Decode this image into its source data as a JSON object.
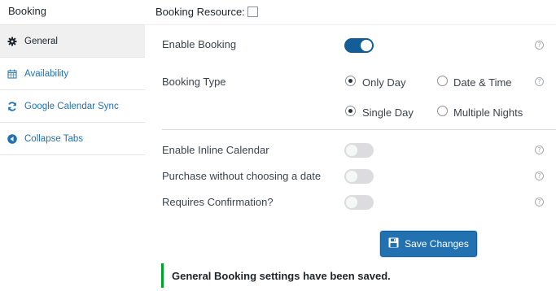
{
  "sidebar": {
    "title": "Booking",
    "items": [
      {
        "label": "General",
        "icon": "gear-icon",
        "active": true
      },
      {
        "label": "Availability",
        "icon": "calendar-icon",
        "active": false
      },
      {
        "label": "Google Calendar Sync",
        "icon": "sync-icon",
        "active": false
      },
      {
        "label": "Collapse Tabs",
        "icon": "collapse-arrow-icon",
        "active": false
      }
    ]
  },
  "header": {
    "booking_resource_label": "Booking Resource:"
  },
  "settings": {
    "enable_booking": {
      "label": "Enable Booking",
      "enabled": true
    },
    "booking_type": {
      "label": "Booking Type",
      "option_only_day": "Only Day",
      "option_date_time": "Date & Time",
      "selected_primary": "Only Day",
      "option_single_day": "Single Day",
      "option_multiple_nights": "Multiple Nights",
      "selected_secondary": "Single Day"
    },
    "inline_calendar": {
      "label": "Enable Inline Calendar",
      "enabled": false
    },
    "purchase_without_date": {
      "label": "Purchase without choosing a date",
      "enabled": false
    },
    "requires_confirmation": {
      "label": "Requires Confirmation?",
      "enabled": false
    }
  },
  "actions": {
    "save_label": "Save Changes"
  },
  "notice": {
    "message": "General Booking settings have been saved."
  },
  "colors": {
    "accent": "#2271b1",
    "toggle_on": "#135e96",
    "success": "#00a32a"
  }
}
